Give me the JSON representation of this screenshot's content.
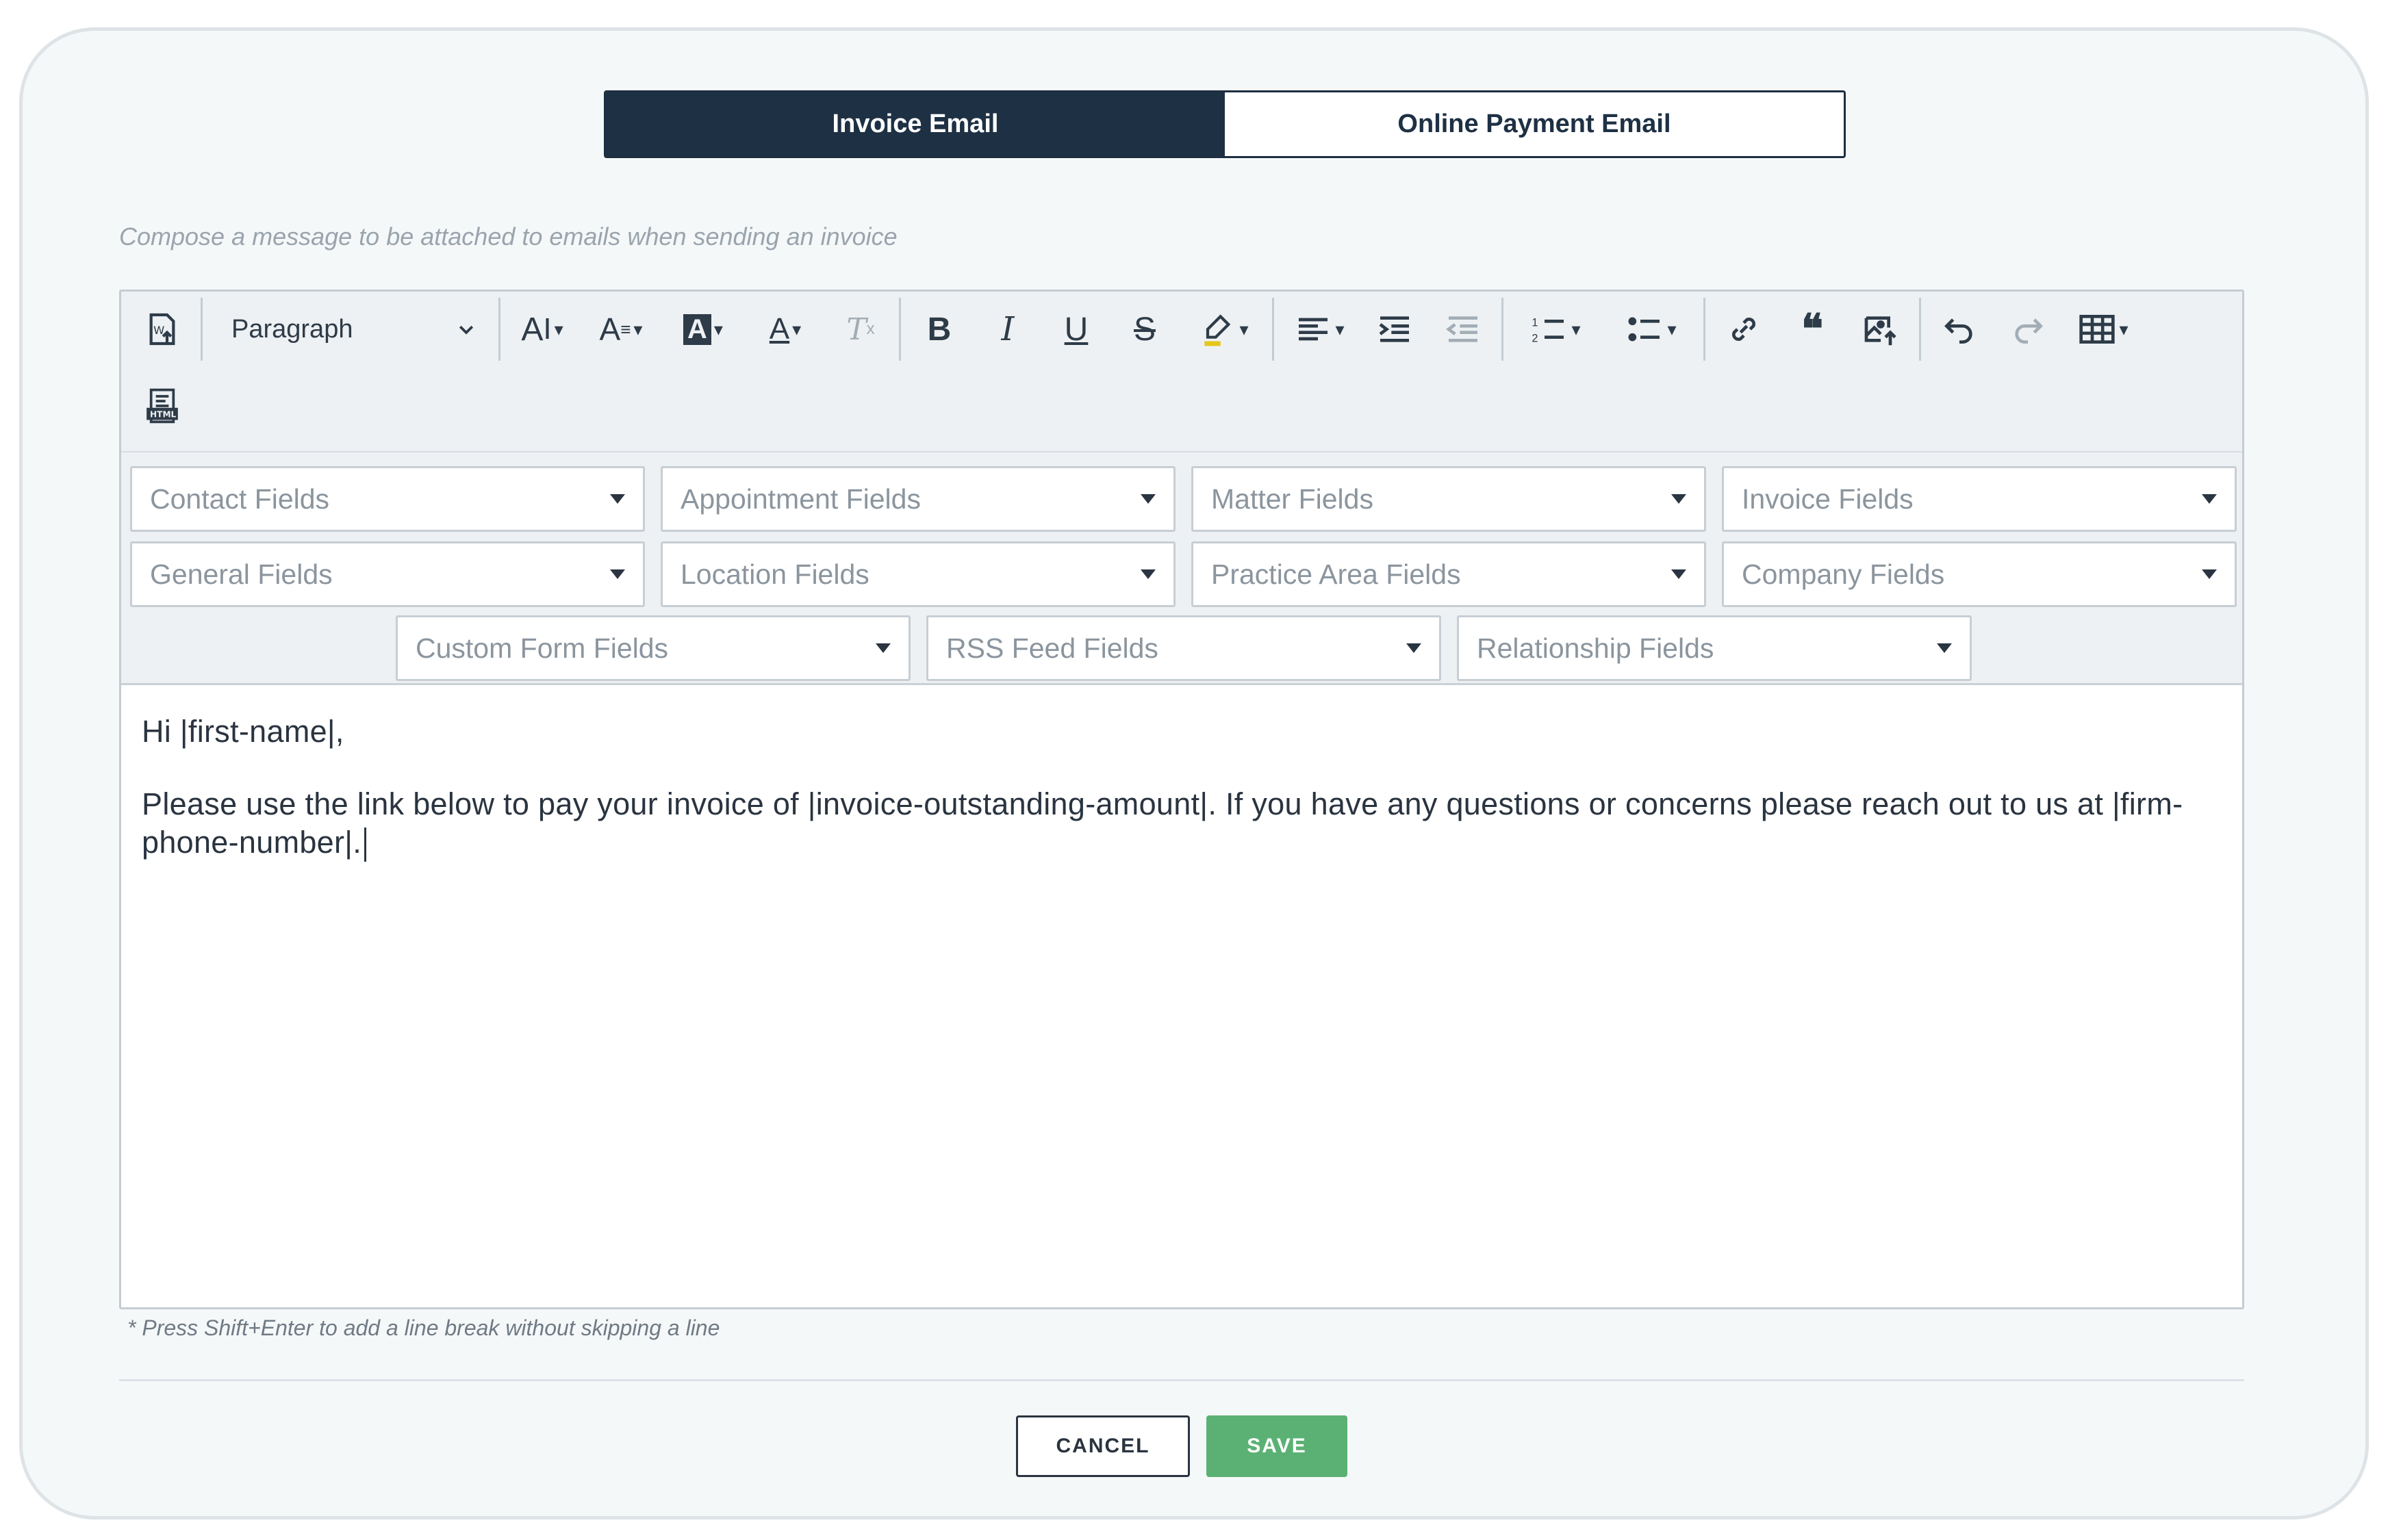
{
  "tabs": [
    {
      "label": "Invoice Email",
      "active": true
    },
    {
      "label": "Online Payment Email",
      "active": false
    }
  ],
  "description": "Compose a message to be attached to emails when sending an invoice",
  "toolbar": {
    "paragraph_label": "Paragraph",
    "icons": [
      "import-word-icon",
      "font-size-icon",
      "line-height-icon",
      "font-background-color-icon",
      "font-color-icon",
      "remove-format-icon",
      "bold-icon",
      "italic-icon",
      "underline-icon",
      "strikethrough-icon",
      "highlight-icon",
      "align-icon",
      "indent-icon",
      "outdent-icon",
      "numbered-list-icon",
      "bulleted-list-icon",
      "link-icon",
      "blockquote-icon",
      "insert-image-icon",
      "undo-icon",
      "redo-icon",
      "table-icon",
      "html-icon"
    ]
  },
  "fields": {
    "row1": [
      "Contact Fields",
      "Appointment Fields",
      "Matter Fields",
      "Invoice Fields"
    ],
    "row2": [
      "General Fields",
      "Location Fields",
      "Practice Area Fields",
      "Company Fields"
    ],
    "row3": [
      "Custom Form Fields",
      "RSS Feed Fields",
      "Relationship Fields"
    ]
  },
  "content": {
    "line1": "Hi |first-name|,",
    "line2": "Please use the link below to pay your invoice of |invoice-outstanding-amount|. If you have any questions or concerns please reach out to us at |firm-phone-number|."
  },
  "hint_bottom": "* Press Shift+Enter to add a line break without skipping a line",
  "buttons": {
    "cancel": "CANCEL",
    "save": "SAVE"
  },
  "colors": {
    "tab_active": "#1e3044",
    "save": "#5bb174"
  }
}
